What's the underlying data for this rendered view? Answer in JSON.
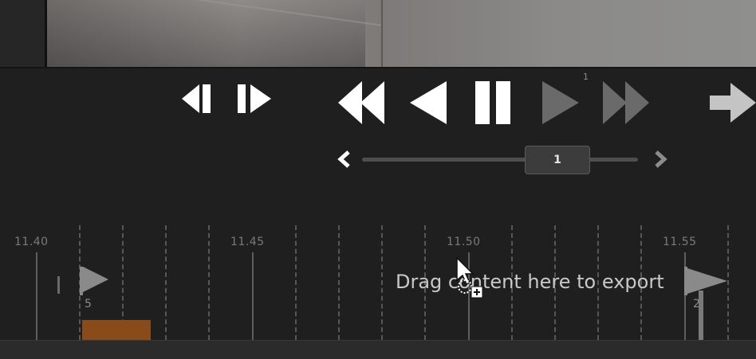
{
  "player": {
    "speed_value": "1",
    "speed_indicator": "1"
  },
  "controls": {
    "step_back_icon": "frame-step-back-icon",
    "step_forward_icon": "frame-step-forward-icon",
    "rewind_icon": "rewind-icon",
    "play_reverse_icon": "play-reverse-icon",
    "pause_icon": "pause-icon",
    "play_icon": "play-icon",
    "fast_forward_icon": "fast-forward-icon",
    "export_icon": "arrow-right-icon"
  },
  "timeline": {
    "time_labels": [
      "11.40",
      "11.45",
      "11.50",
      "11.55"
    ],
    "marker_left_count": "5",
    "marker_right_count": "2",
    "export_hint": "Drag content here to export"
  },
  "colors": {
    "background": "#1f1f1f",
    "control_icon": "#ffffff",
    "control_disabled": "#6a6a6a",
    "recording_segment": "#8a4b1a",
    "flag": "#8a8a8a"
  }
}
